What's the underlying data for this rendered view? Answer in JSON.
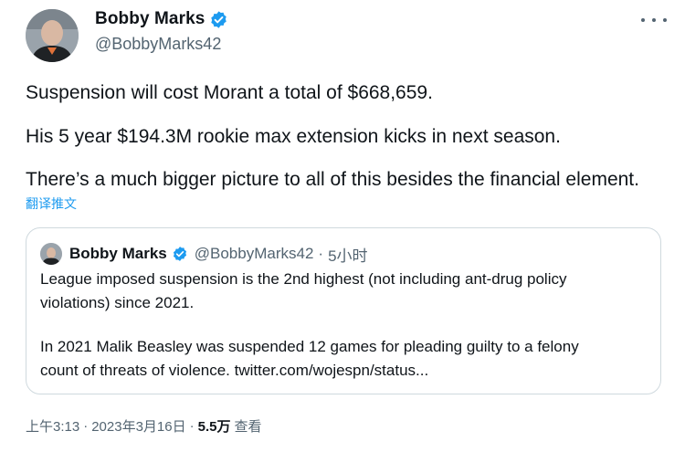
{
  "author": {
    "name": "Bobby Marks",
    "handle": "@BobbyMarks42"
  },
  "tweet": {
    "lines": [
      "Suspension will cost Morant a total of $668,659.",
      "His 5 year $194.3M rookie max extension kicks in next season.",
      "There’s a much bigger picture to all of this besides the financial element."
    ],
    "translate_label": "翻译推文"
  },
  "quoted_tweet": {
    "name": "Bobby Marks",
    "handle": "@BobbyMarks42",
    "separator": "·",
    "time": "5小时",
    "lines": [
      "League imposed suspension is the 2nd highest (not including ant-drug policy",
      "violations) since 2021.",
      "In 2021 Malik Beasley was suspended 12 games for pleading guilty to a felony",
      "count of threats of violence. twitter.com/wojespn/status..."
    ]
  },
  "meta": {
    "time": "上午3:13",
    "separator": "·",
    "date": "2023年3月16日",
    "views": "5.5万",
    "views_label": "查看"
  },
  "colors": {
    "accent": "#1d9bf0",
    "secondary_text": "#536471",
    "border": "#cfd9de"
  },
  "icons": [
    "verified-badge-icon",
    "more-options-icon"
  ]
}
